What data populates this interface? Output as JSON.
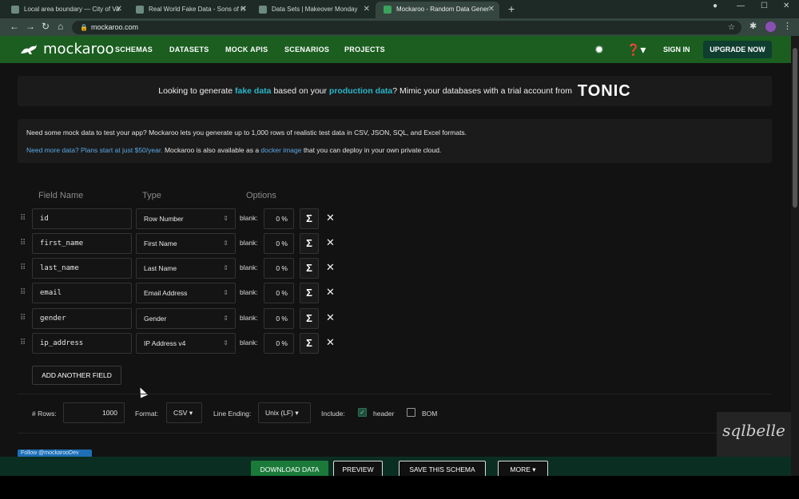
{
  "browser": {
    "tabs": [
      {
        "title": "Local area boundary — City of Va"
      },
      {
        "title": "Real World Fake Data - Sons of H"
      },
      {
        "title": "Data Sets | Makeover Monday"
      },
      {
        "title": "Mockaroo - Random Data Gener"
      }
    ],
    "url": "mockaroo.com"
  },
  "header": {
    "logo": "mockaroo",
    "nav": [
      "SCHEMAS",
      "DATASETS",
      "MOCK APIS",
      "SCENARIOS",
      "PROJECTS"
    ],
    "sign_in": "SIGN IN",
    "upgrade": "UPGRADE NOW"
  },
  "promo": {
    "before": "Looking to generate ",
    "fake": "fake data",
    "middle": " based on your ",
    "prod": "production data",
    "after": "? Mimic your databases with a trial account from",
    "brand": "TONIC"
  },
  "info": {
    "line1": "Need some mock data to test your app? Mockaroo lets you generate up to 1,000 rows of realistic test data in CSV, JSON, SQL, and Excel formats.",
    "link1": "Need more data? Plans start at just $50/year.",
    "mid": " Mockaroo is also available as a ",
    "link2": "docker image",
    "end": " that you can deploy in your own private cloud."
  },
  "columns": {
    "field_name": "Field Name",
    "type": "Type",
    "options": "Options"
  },
  "fields": [
    {
      "name": "id",
      "type": "Row Number",
      "blank_label": "blank:",
      "blank": "0 %"
    },
    {
      "name": "first_name",
      "type": "First Name",
      "blank_label": "blank:",
      "blank": "0 %"
    },
    {
      "name": "last_name",
      "type": "Last Name",
      "blank_label": "blank:",
      "blank": "0 %"
    },
    {
      "name": "email",
      "type": "Email Address",
      "blank_label": "blank:",
      "blank": "0 %"
    },
    {
      "name": "gender",
      "type": "Gender",
      "blank_label": "blank:",
      "blank": "0 %"
    },
    {
      "name": "ip_address",
      "type": "IP Address v4",
      "blank_label": "blank:",
      "blank": "0 %"
    }
  ],
  "add_field": "ADD ANOTHER FIELD",
  "options": {
    "rows_label": "# Rows:",
    "rows": "1000",
    "format_label": "Format:",
    "format": "CSV",
    "line_ending_label": "Line Ending:",
    "line_ending": "Unix (LF)",
    "include_label": "Include:",
    "header": "header",
    "bom": "BOM"
  },
  "follow": "Follow @mockarooDev",
  "actions": {
    "download": "DOWNLOAD DATA",
    "preview": "PREVIEW",
    "save": "SAVE THIS SCHEMA",
    "more": "MORE"
  },
  "watermark": "sqlbelle"
}
